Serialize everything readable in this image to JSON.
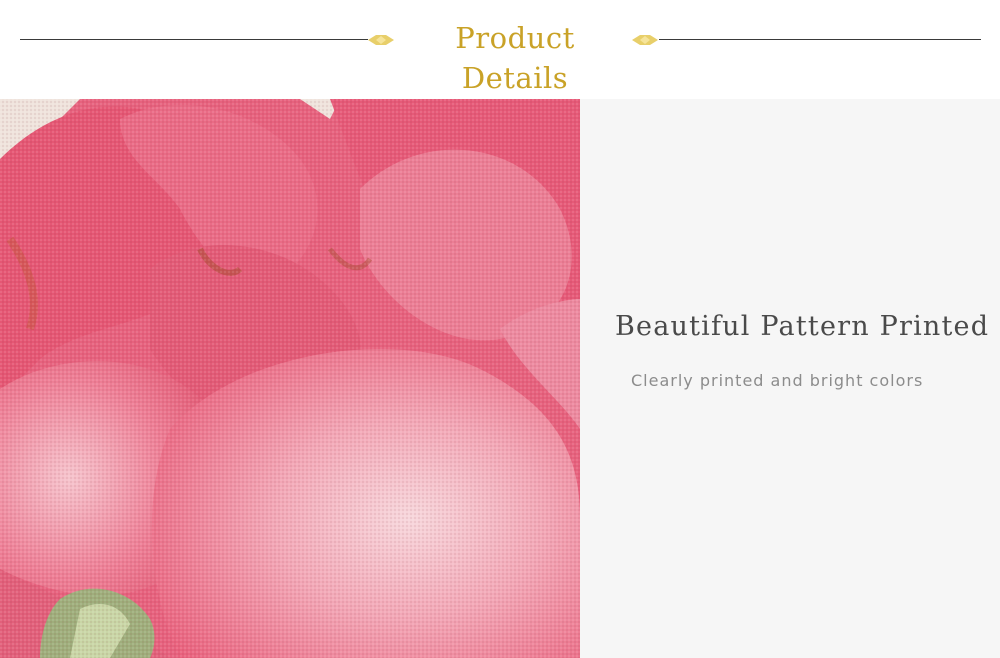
{
  "header": {
    "title": "Product Details",
    "accent_color": "#c9a227",
    "ornament_icon": "diamond-ornament-icon"
  },
  "photo": {
    "subject": "pink-flower-fabric-closeup",
    "main_color": "#e86784"
  },
  "feature": {
    "heading": "Beautiful Pattern Printed",
    "description": "Clearly printed and bright colors"
  }
}
